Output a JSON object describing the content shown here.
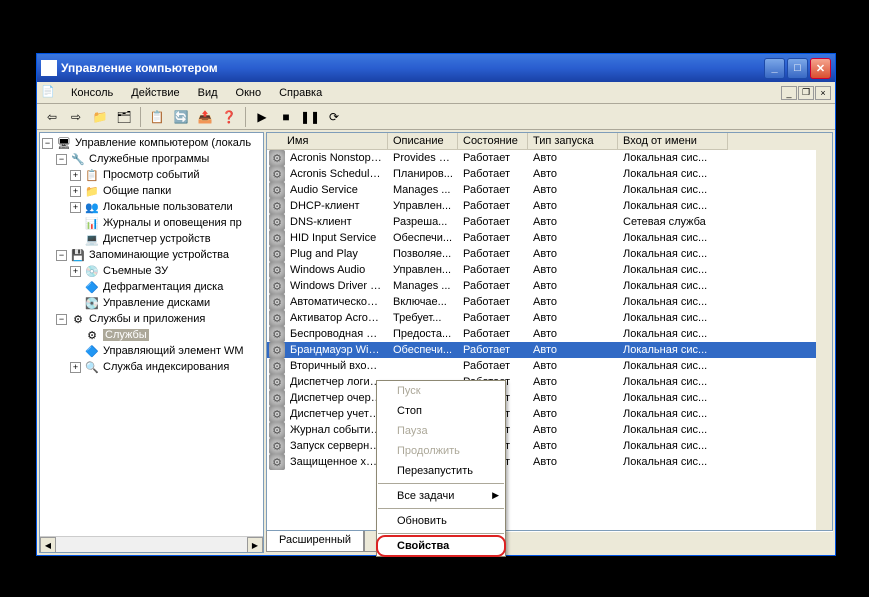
{
  "window": {
    "title": "Управление компьютером"
  },
  "menu": {
    "console": "Консоль",
    "action": "Действие",
    "view": "Вид",
    "window": "Окно",
    "help": "Справка"
  },
  "tree": {
    "root": "Управление компьютером (локаль",
    "sys": "Служебные программы",
    "sys_items": [
      "Просмотр событий",
      "Общие папки",
      "Локальные пользователи",
      "Журналы и оповещения пр",
      "Диспетчер устройств"
    ],
    "storage": "Запоминающие устройства",
    "storage_items": [
      "Съемные ЗУ",
      "Дефрагментация диска",
      "Управление дисками"
    ],
    "svc": "Службы и приложения",
    "svc_items": [
      "Службы",
      "Управляющий элемент WM",
      "Служба индексирования"
    ]
  },
  "columns": {
    "name": "Имя",
    "desc": "Описание",
    "state": "Состояние",
    "start": "Тип запуска",
    "logon": "Вход от имени"
  },
  "running": "Работает",
  "auto": "Авто",
  "local": "Локальная сис...",
  "netsvc": "Сетевая служба",
  "services": [
    {
      "name": "Acronis Nonstop Ba...",
      "desc": "Provides n..."
    },
    {
      "name": "Acronis Scheduler2 ...",
      "desc": "Планиров..."
    },
    {
      "name": "Audio Service",
      "desc": "Manages ..."
    },
    {
      "name": "DHCP-клиент",
      "desc": "Управлен..."
    },
    {
      "name": "DNS-клиент",
      "desc": "Разреша...",
      "logon": "net"
    },
    {
      "name": "HID Input Service",
      "desc": "Обеспечи..."
    },
    {
      "name": "Plug and Play",
      "desc": "Позволяе..."
    },
    {
      "name": "Windows Audio",
      "desc": "Управлен..."
    },
    {
      "name": "Windows Driver Fo...",
      "desc": "Manages ..."
    },
    {
      "name": "Автоматическое о...",
      "desc": "Включае..."
    },
    {
      "name": "Активатор Acronis...",
      "desc": "Требует..."
    },
    {
      "name": "Беспроводная нас...",
      "desc": "Предоста..."
    },
    {
      "name": "Брандмауэр Windo...",
      "desc": "Обеспечи...",
      "selected": true
    },
    {
      "name": "Вторичный вход ...",
      "desc": ""
    },
    {
      "name": "Диспетчер логич...",
      "desc": ""
    },
    {
      "name": "Диспетчер очере...",
      "desc": ""
    },
    {
      "name": "Диспетчер учетн...",
      "desc": ""
    },
    {
      "name": "Журнал событий ...",
      "desc": ""
    },
    {
      "name": "Запуск серверны...",
      "desc": ""
    },
    {
      "name": "Защищенное хра...",
      "desc": ""
    }
  ],
  "tabs": {
    "ext": "Расширенный",
    "std": "С"
  },
  "ctx": {
    "start": "Пуск",
    "stop": "Стоп",
    "pause": "Пауза",
    "resume": "Продолжить",
    "restart": "Перезапустить",
    "alltasks": "Все задачи",
    "refresh": "Обновить",
    "properties": "Свойства"
  }
}
